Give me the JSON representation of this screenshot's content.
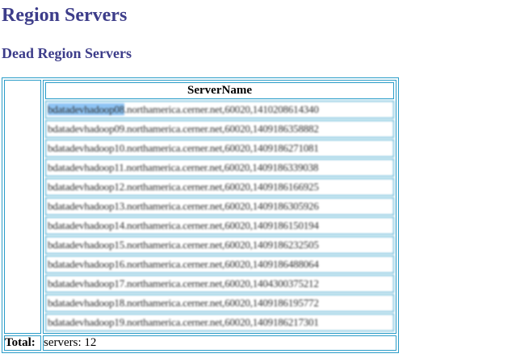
{
  "page": {
    "title": "Region Servers",
    "subtitle": "Dead Region Servers"
  },
  "table": {
    "column_header": "ServerName",
    "rows": [
      "bdatadevhadoop08.northamerica.cerner.net,60020,1410208614340",
      "bdatadevhadoop09.northamerica.cerner.net,60020,1409186358882",
      "bdatadevhadoop10.northamerica.cerner.net,60020,1409186271081",
      "bdatadevhadoop11.northamerica.cerner.net,60020,1409186339038",
      "bdatadevhadoop12.northamerica.cerner.net,60020,1409186166925",
      "bdatadevhadoop13.northamerica.cerner.net,60020,1409186305926",
      "bdatadevhadoop14.northamerica.cerner.net,60020,1409186150194",
      "bdatadevhadoop15.northamerica.cerner.net,60020,1409186232505",
      "bdatadevhadoop16.northamerica.cerner.net,60020,1409186488064",
      "bdatadevhadoop17.northamerica.cerner.net,60020,1404300375212",
      "bdatadevhadoop18.northamerica.cerner.net,60020,1409186195772",
      "bdatadevhadoop19.northamerica.cerner.net,60020,1409186217301"
    ],
    "total_label": "Total:",
    "total_value": "servers: 12"
  },
  "colors": {
    "heading": "#3d3d8a",
    "border": "#2a9cc8",
    "selection": "#8ec4f5"
  }
}
